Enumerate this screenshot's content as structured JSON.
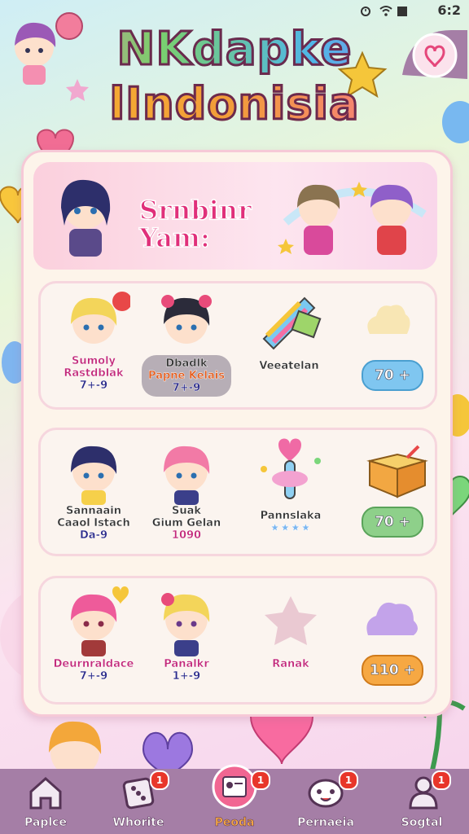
{
  "status_bar": {
    "time": "6:2"
  },
  "app": {
    "title_line1": "NKdapke",
    "title_line2": "lIndonisia"
  },
  "header": {
    "title_line1": "Srnbinr",
    "title_line2": "Yam:"
  },
  "rows": [
    {
      "items": [
        {
          "name": "Sumoly",
          "sub": "Rastdblak",
          "price": "7+-9"
        },
        {
          "name": "Dbadlk",
          "sub": "Papne Kelais",
          "price": "7+-9"
        },
        {
          "name": "Veeatelan",
          "sub": "",
          "price": ""
        }
      ],
      "button": "70 +"
    },
    {
      "items": [
        {
          "name": "Sannaain",
          "sub": "Caaol Istach",
          "price": "Da-9"
        },
        {
          "name": "Suak",
          "sub": "Gium Gelan",
          "price": "1090"
        },
        {
          "name": "Pannslaka",
          "sub": "",
          "price": ""
        }
      ],
      "button": "70 +"
    },
    {
      "items": [
        {
          "name": "Deurnraldace",
          "sub": "",
          "price": "7+-9"
        },
        {
          "name": "Panalkr",
          "sub": "",
          "price": "1+-9"
        },
        {
          "name": "Ranak",
          "sub": "",
          "price": ""
        }
      ],
      "button": "110 +"
    }
  ],
  "nav": [
    {
      "label": "Paplce",
      "badge": ""
    },
    {
      "label": "Whorite",
      "badge": "1"
    },
    {
      "label": "Peoda",
      "badge": "1"
    },
    {
      "label": "Pernaeia",
      "badge": "1"
    },
    {
      "label": "Sogtal",
      "badge": "1"
    }
  ],
  "colors": {
    "accent_pink": "#e0307a",
    "button_blue": "#7fc6f0",
    "button_green": "#8ed08a",
    "button_orange": "#f6a843",
    "nav_bg": "#a57ea6"
  }
}
